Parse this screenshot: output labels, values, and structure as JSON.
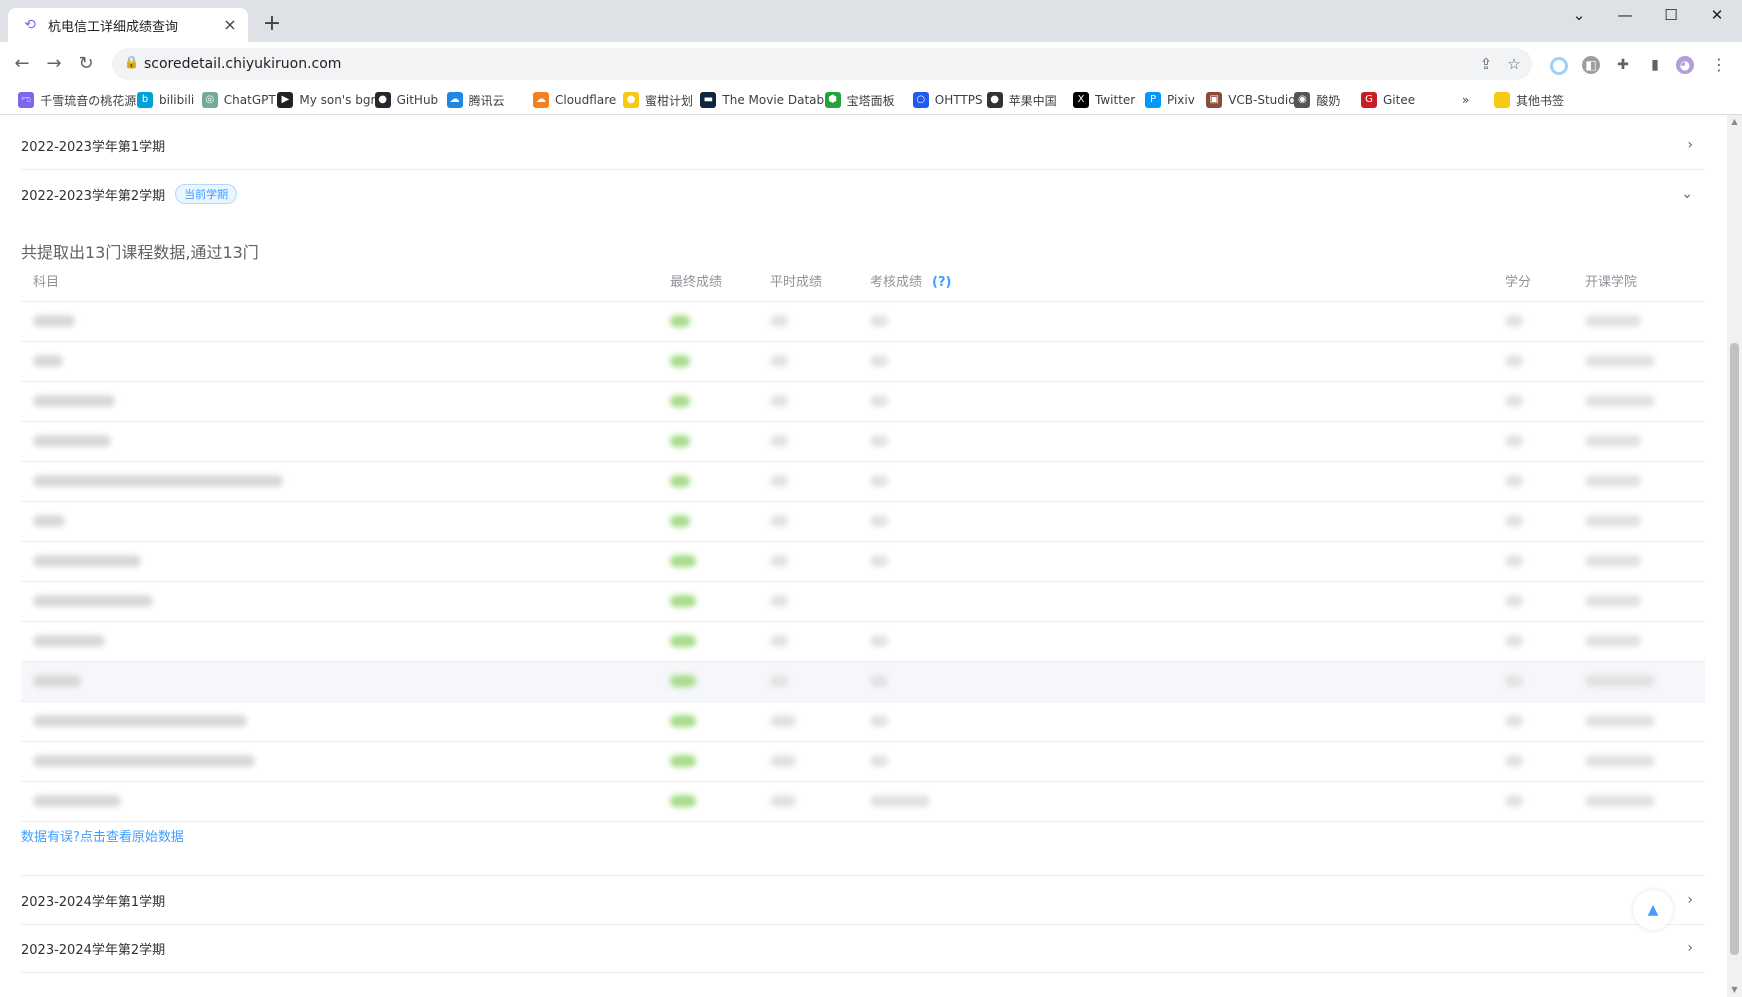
{
  "browser": {
    "tab_title": "杭电信工详细成绩查询",
    "tab_favicon": "⟲",
    "url": "scoredetail.chiyukiruon.com",
    "bookmarks": [
      {
        "label": "千雪琉音の桃花源",
        "icon": "ಌ",
        "color": "#7b68ee"
      },
      {
        "label": "bilibili",
        "icon": "b",
        "color": "#00a1d6"
      },
      {
        "label": "ChatGPT",
        "icon": "◎",
        "color": "#74aa9c"
      },
      {
        "label": "My son's bgm",
        "icon": "▶",
        "color": "#222"
      },
      {
        "label": "GitHub",
        "icon": "●",
        "color": "#24292e"
      },
      {
        "label": "腾讯云",
        "icon": "☁",
        "color": "#1e88e5"
      },
      {
        "label": "Cloudflare",
        "icon": "☁",
        "color": "#f38020"
      },
      {
        "label": "蜜柑计划",
        "icon": "●",
        "color": "#f6c915"
      },
      {
        "label": "The Movie Datab...",
        "icon": "▬",
        "color": "#0d253f"
      },
      {
        "label": "宝塔面板",
        "icon": "⬢",
        "color": "#20a53a"
      },
      {
        "label": "OHTTPS",
        "icon": "○",
        "color": "#1e5cf0"
      },
      {
        "label": "苹果中国",
        "icon": "●",
        "color": "#333"
      },
      {
        "label": "Twitter",
        "icon": "X",
        "color": "#000"
      },
      {
        "label": "Pixiv",
        "icon": "P",
        "color": "#0096fa"
      },
      {
        "label": "VCB-Studio",
        "icon": "▣",
        "color": "#8b4a3a"
      },
      {
        "label": "酸奶",
        "icon": "◉",
        "color": "#555"
      },
      {
        "label": "Gitee",
        "icon": "G",
        "color": "#c71d23"
      }
    ],
    "bookmarks_more": "»",
    "other_bookmarks": "其他书签"
  },
  "semesters": {
    "s1": {
      "title": "2022-2023学年第1学期"
    },
    "s2": {
      "title": "2022-2023学年第2学期",
      "badge": "当前学期"
    },
    "s3": {
      "title": "2023-2024学年第1学期"
    },
    "s4": {
      "title": "2023-2024学年第2学期"
    }
  },
  "summary": "共提取出13门课程数据,通过13门",
  "table": {
    "headers": {
      "subject": "科目",
      "final": "最终成绩",
      "usual": "平时成绩",
      "exam": "考核成绩",
      "help": "(?)",
      "credit": "学分",
      "college": "开课学院"
    }
  },
  "link_text": "数据有误?点击查看原始数据",
  "back_to_top_icon": "▲"
}
